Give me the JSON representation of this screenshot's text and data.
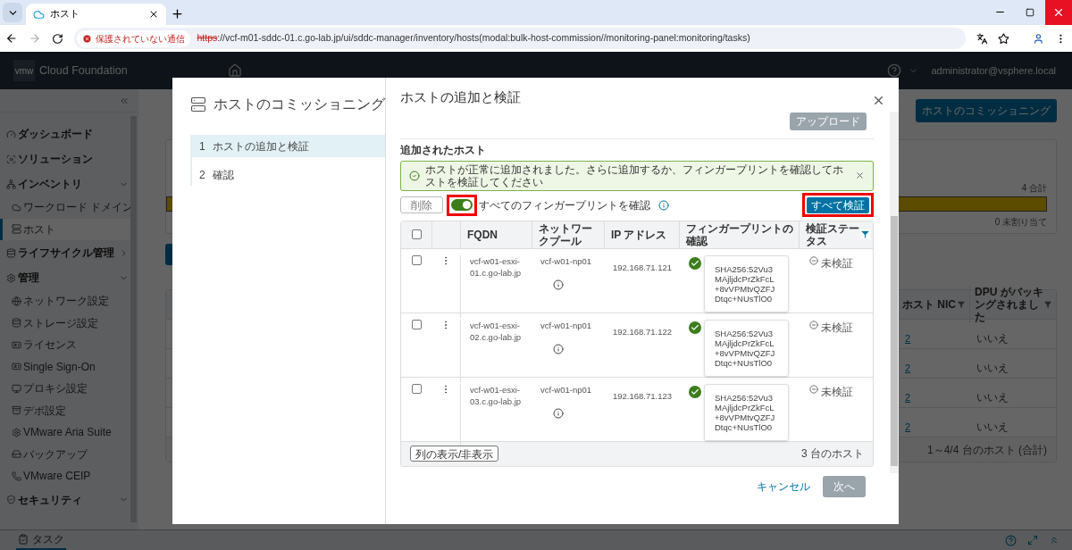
{
  "browser": {
    "tab_title": "ホスト",
    "security_label": "保護されていない通信",
    "url_scheme": "https",
    "url_rest": "://vcf-m01-sddc-01.c.go-lab.jp/ui/sddc-manager/inventory/hosts(modal:bulk-host-commission//monitoring-panel:monitoring/tasks)"
  },
  "header": {
    "logo": "vmw",
    "product": "Cloud Foundation",
    "user": "administrator@vsphere.local"
  },
  "sidebar": {
    "items": [
      {
        "label": "ダッシュボード",
        "selected": false
      },
      {
        "label": "ソリューション",
        "selected": false
      },
      {
        "label": "インベントリ",
        "selected": false,
        "expanded": true,
        "children": [
          {
            "label": "ワークロード ドメイン",
            "selected": false
          },
          {
            "label": "ホスト",
            "selected": true
          }
        ]
      },
      {
        "label": "ライフサイクル管理",
        "selected": false,
        "expanded": false
      },
      {
        "label": "管理",
        "selected": false,
        "expanded": true,
        "children": [
          {
            "label": "ネットワーク設定",
            "selected": false
          },
          {
            "label": "ストレージ設定",
            "selected": false
          },
          {
            "label": "ライセンス",
            "selected": false
          },
          {
            "label": "Single Sign-On",
            "selected": false
          },
          {
            "label": "プロキシ設定",
            "selected": false
          },
          {
            "label": "デポ設定",
            "selected": false
          },
          {
            "label": "VMware Aria Suite",
            "selected": false
          },
          {
            "label": "バックアップ",
            "selected": false
          },
          {
            "label": "VMware CEIP",
            "selected": false
          }
        ]
      },
      {
        "label": "セキュリティ",
        "selected": false,
        "expanded": true
      }
    ]
  },
  "page": {
    "commission_button": "ホストのコミッショニング",
    "capacity": {
      "total": "4 合計",
      "level": 1,
      "unassigned": "0 未割り当て"
    },
    "table": {
      "columns": [
        "ホスト NIC",
        "DPU がバッキングされました"
      ],
      "rows": [
        {
          "host_nic": "2",
          "dpu_backed": "いいえ"
        },
        {
          "host_nic": "2",
          "dpu_backed": "いいえ"
        },
        {
          "host_nic": "2",
          "dpu_backed": "いいえ"
        },
        {
          "host_nic": "2",
          "dpu_backed": "いいえ"
        }
      ],
      "footer": "1～4/4 台のホスト (合計)"
    }
  },
  "taskbar": {
    "tab": "タスク"
  },
  "modal": {
    "wizard_title": "ホストのコミッショニング",
    "steps": [
      {
        "number": "1",
        "label": "ホストの追加と検証",
        "selected": true
      },
      {
        "number": "2",
        "label": "確認",
        "selected": false
      }
    ],
    "title": "ホストの追加と検証",
    "upload_button": {
      "label": "アップロード",
      "disabled": true
    },
    "section_title": "追加されたホスト",
    "alert": "ホストが正常に追加されました。さらに追加するか、フィンガープリントを確認してホストを検証してください",
    "delete_button": {
      "label": "削除",
      "disabled": true
    },
    "fingerprint_toggle": {
      "label": "すべてのフィンガープリントを確認",
      "on": true
    },
    "verify_all_button": "すべて検証",
    "table": {
      "select_all_checked": false,
      "columns": [
        "FQDN",
        "ネットワークプール",
        "IP アドレス",
        "フィンガープリントの確認",
        "検証ステータス"
      ],
      "rows": [
        {
          "checked": false,
          "fqdn": "vcf-w01-esxi-01.c.go-lab.jp",
          "network_pool": "vcf-w01-np01",
          "ip": "192.168.71.121",
          "fingerprint_confirmed": true,
          "fingerprint": "SHA256:52Vu3MAjljdcPrZkFcL+8vVPMtvQZFJDtqc+NUsTlO0",
          "status": "未検証"
        },
        {
          "checked": false,
          "fqdn": "vcf-w01-esxi-02.c.go-lab.jp",
          "network_pool": "vcf-w01-np01",
          "ip": "192.168.71.122",
          "fingerprint_confirmed": true,
          "fingerprint": "SHA256:52Vu3MAjljdcPrZkFcL+8vVPMtvQZFJDtqc+NUsTlO0",
          "status": "未検証"
        },
        {
          "checked": false,
          "fqdn": "vcf-w01-esxi-03.c.go-lab.jp",
          "network_pool": "vcf-w01-np01",
          "ip": "192.168.71.123",
          "fingerprint_confirmed": true,
          "fingerprint": "SHA256:52Vu3MAjljdcPrZkFcL+8vVPMtvQZFJDtqc+NUsTlO0",
          "status": "未検証"
        }
      ],
      "column_toggle_button": "列の表示/非表示",
      "count": "3 台のホスト"
    },
    "cancel": "キャンセル",
    "next_button": {
      "label": "次へ",
      "disabled": true
    }
  }
}
